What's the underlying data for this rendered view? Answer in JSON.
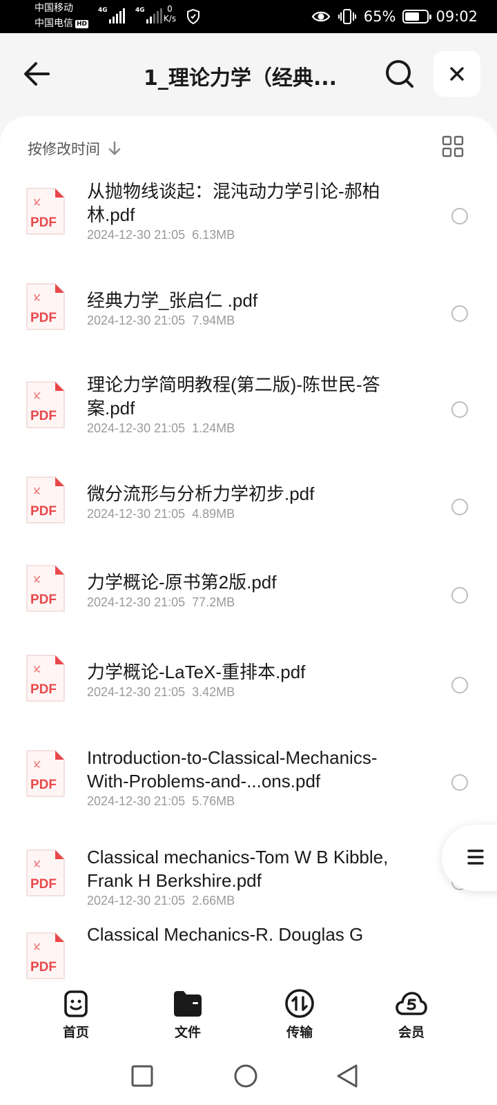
{
  "status_bar": {
    "carrier_1": "中国移动",
    "carrier_2": "中国电信",
    "hd": "HD",
    "tech_1": "4G",
    "tech_2": "4G",
    "net_speed_value": "0",
    "net_speed_unit": "K/s",
    "battery_percent": "65%",
    "battery_level": 0.65,
    "time": "09:02"
  },
  "header": {
    "title": "1_理论力学（经典..."
  },
  "sort": {
    "label": "按修改时间"
  },
  "files": [
    {
      "name": "从抛物线谈起：混沌动力学引论-郝柏林.pdf",
      "date": "2024-12-30 21:05",
      "size": "6.13MB",
      "icon_label": "PDF"
    },
    {
      "name": "经典力学_张启仁 .pdf",
      "date": "2024-12-30 21:05",
      "size": "7.94MB",
      "icon_label": "PDF"
    },
    {
      "name": "理论力学简明教程(第二版)-陈世民-答案.pdf",
      "date": "2024-12-30 21:05",
      "size": "1.24MB",
      "icon_label": "PDF"
    },
    {
      "name": "微分流形与分析力学初步.pdf",
      "date": "2024-12-30 21:05",
      "size": "4.89MB",
      "icon_label": "PDF"
    },
    {
      "name": "力学概论-原书第2版.pdf",
      "date": "2024-12-30 21:05",
      "size": "77.2MB",
      "icon_label": "PDF"
    },
    {
      "name": "力学概论-LaTeX-重排本.pdf",
      "date": "2024-12-30 21:05",
      "size": "3.42MB",
      "icon_label": "PDF"
    },
    {
      "name": "Introduction-to-Classical-Mechanics-With-Problems-and-...ons.pdf",
      "date": "2024-12-30 21:05",
      "size": "5.76MB",
      "icon_label": "PDF"
    },
    {
      "name": "Classical mechanics-Tom W B Kibble, Frank H Berkshire.pdf",
      "date": "2024-12-30 21:05",
      "size": "2.66MB",
      "icon_label": "PDF"
    },
    {
      "name": "Classical Mechanics-R. Douglas G",
      "date": "",
      "size": "",
      "icon_label": "PDF"
    }
  ],
  "bottom_nav": [
    {
      "label": "首页",
      "icon": "home-face-icon"
    },
    {
      "label": "文件",
      "icon": "folder-icon"
    },
    {
      "label": "传输",
      "icon": "transfer-icon"
    },
    {
      "label": "会员",
      "icon": "cloud-vip-icon"
    }
  ],
  "colors": {
    "pdf_red": "#e8484a",
    "accent_dark": "#1a1a1a",
    "meta_gray": "#9a9a9a"
  }
}
